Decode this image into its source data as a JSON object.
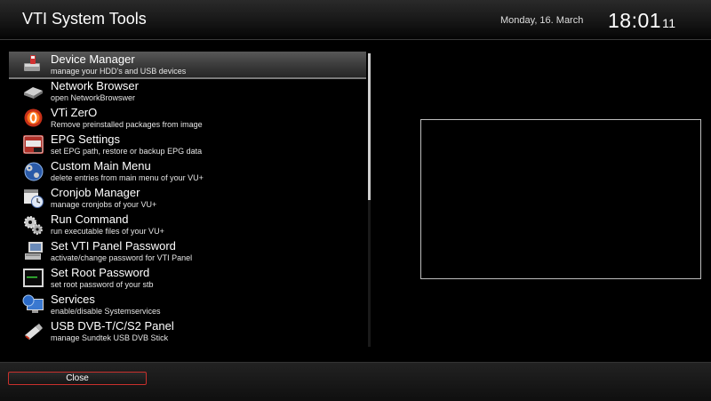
{
  "header": {
    "title": "VTI System Tools",
    "date": "Monday, 16. March",
    "time_hm": "18:01",
    "time_sec": "11"
  },
  "menu": {
    "items": [
      {
        "name": "Device Manager",
        "desc": "manage your HDD's and USB devices",
        "icon": "hdd-usb-icon"
      },
      {
        "name": "Network Browser",
        "desc": "open NetworkBrowswer",
        "icon": "network-drive-icon"
      },
      {
        "name": "VTi ZerO",
        "desc": "Remove preinstalled packages from image",
        "icon": "zero-badge-icon"
      },
      {
        "name": "EPG Settings",
        "desc": "set EPG path, restore or backup EPG data",
        "icon": "epg-dvb-icon"
      },
      {
        "name": "Custom Main Menu",
        "desc": "delete entries from main menu of your VU+",
        "icon": "globe-gears-icon"
      },
      {
        "name": "Cronjob Manager",
        "desc": "manage cronjobs of your VU+",
        "icon": "calendar-clock-icon"
      },
      {
        "name": "Run Command",
        "desc": "run executable files of your VU+",
        "icon": "gears-icon"
      },
      {
        "name": "Set VTI Panel Password",
        "desc": "activate/change password for VTI Panel",
        "icon": "computer-icon"
      },
      {
        "name": "Set Root Password",
        "desc": "set root password of your stb",
        "icon": "terminal-icon"
      },
      {
        "name": "Services",
        "desc": "enable/disable Systemservices",
        "icon": "monitor-globe-icon"
      },
      {
        "name": "USB DVB-T/C/S2 Panel",
        "desc": "manage Sundtek USB DVB Stick",
        "icon": "usb-stick-icon"
      }
    ],
    "selected_index": 0,
    "scroll_fraction": 0.5
  },
  "footer": {
    "close_label": "Close"
  },
  "colors": {
    "accent_red": "#c8302c"
  }
}
